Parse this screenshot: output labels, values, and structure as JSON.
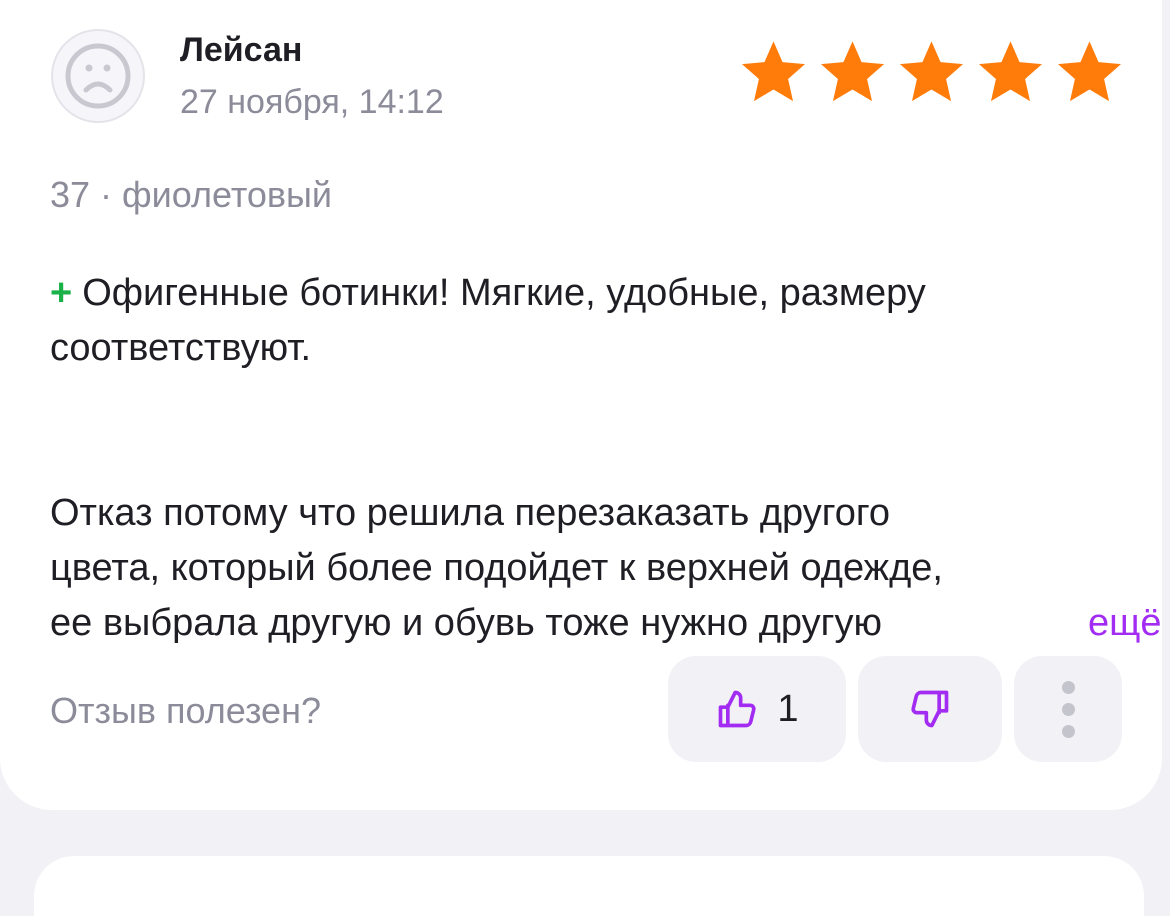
{
  "review": {
    "author": "Лейсан",
    "date": "27 ноября, 14:12",
    "rating": 5,
    "rating_max": 5,
    "variant": "37 · фиолетовый",
    "plus_mark": "+",
    "plus_text": "Офигенные ботинки! Мягкие, удобные, размеру соответствуют.",
    "text_line_1": "Отказ потому что решила перезаказать другого",
    "text_line_2": "цвета, который более подойдет к верхней одежде,",
    "text_line_3": "ее выбрала другую и обувь тоже нужно другую",
    "more_label": "ещё"
  },
  "feedback": {
    "question": "Отзыв полезен?",
    "likes": "1"
  },
  "colors": {
    "star": "#ff7c0a",
    "accent": "#a22cf2",
    "plus": "#1ab248",
    "muted_text": "#8b8b99",
    "button_bg": "#f2f1f6"
  },
  "icons": {
    "avatar": "sad-face-avatar-icon",
    "star": "star-icon",
    "like": "thumbs-up-icon",
    "dislike": "thumbs-down-icon",
    "menu": "more-vertical-icon"
  }
}
